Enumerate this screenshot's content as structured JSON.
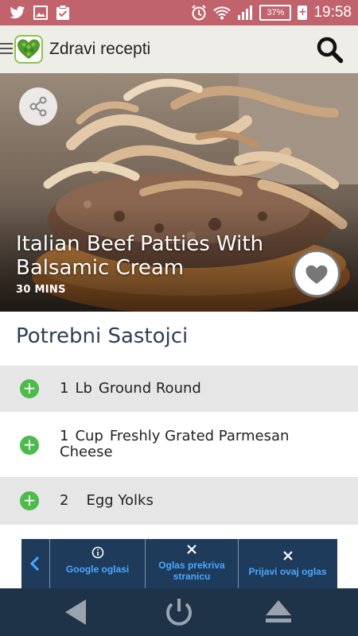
{
  "status_bar": {
    "time": "19:58",
    "battery": "37%",
    "battery_charging_symbol": "+",
    "left_icons": [
      "twitter-icon",
      "image-icon",
      "clipboard-check-icon"
    ],
    "right_icons": [
      "alarm-icon",
      "wifi-icon",
      "signal-icon",
      "mute-icon"
    ]
  },
  "app_bar": {
    "title": "Zdravi recepti",
    "icons": [
      "menu-icon",
      "app-logo",
      "search-icon"
    ]
  },
  "hero": {
    "title": "Italian Beef Patties With Balsamic Cream",
    "time": "30 MINS",
    "icons": [
      "share-icon",
      "heart-icon"
    ]
  },
  "ingredients": {
    "heading": "Potrebni Sastojci",
    "items": [
      {
        "qty": "1",
        "unit": "Lb",
        "name": "Ground Round"
      },
      {
        "qty": "1",
        "unit": "Cup",
        "name": "Freshly Grated Parmesan Cheese"
      },
      {
        "qty": "2",
        "unit": "",
        "name": "Egg Yolks"
      }
    ]
  },
  "ad_bar": {
    "google_ads": "Google oglasi",
    "covers_page": "Oglas prekriva stranicu",
    "report_ad": "Prijavi ovaj oglas",
    "icons": [
      "chevron-left-icon",
      "info-icon",
      "close-icon",
      "close-icon"
    ]
  },
  "nav_bar": {
    "icons": [
      "back-icon",
      "home-icon",
      "eject-icon"
    ]
  },
  "colors": {
    "status_bar": "#c1636c",
    "app_bar": "#efede8",
    "heading": "#2e3f56",
    "plus": "#4cbb4c",
    "ad_bg": "#1e3b5c",
    "ad_text": "#4aa8ff",
    "nav_bar": "#1f3348"
  }
}
